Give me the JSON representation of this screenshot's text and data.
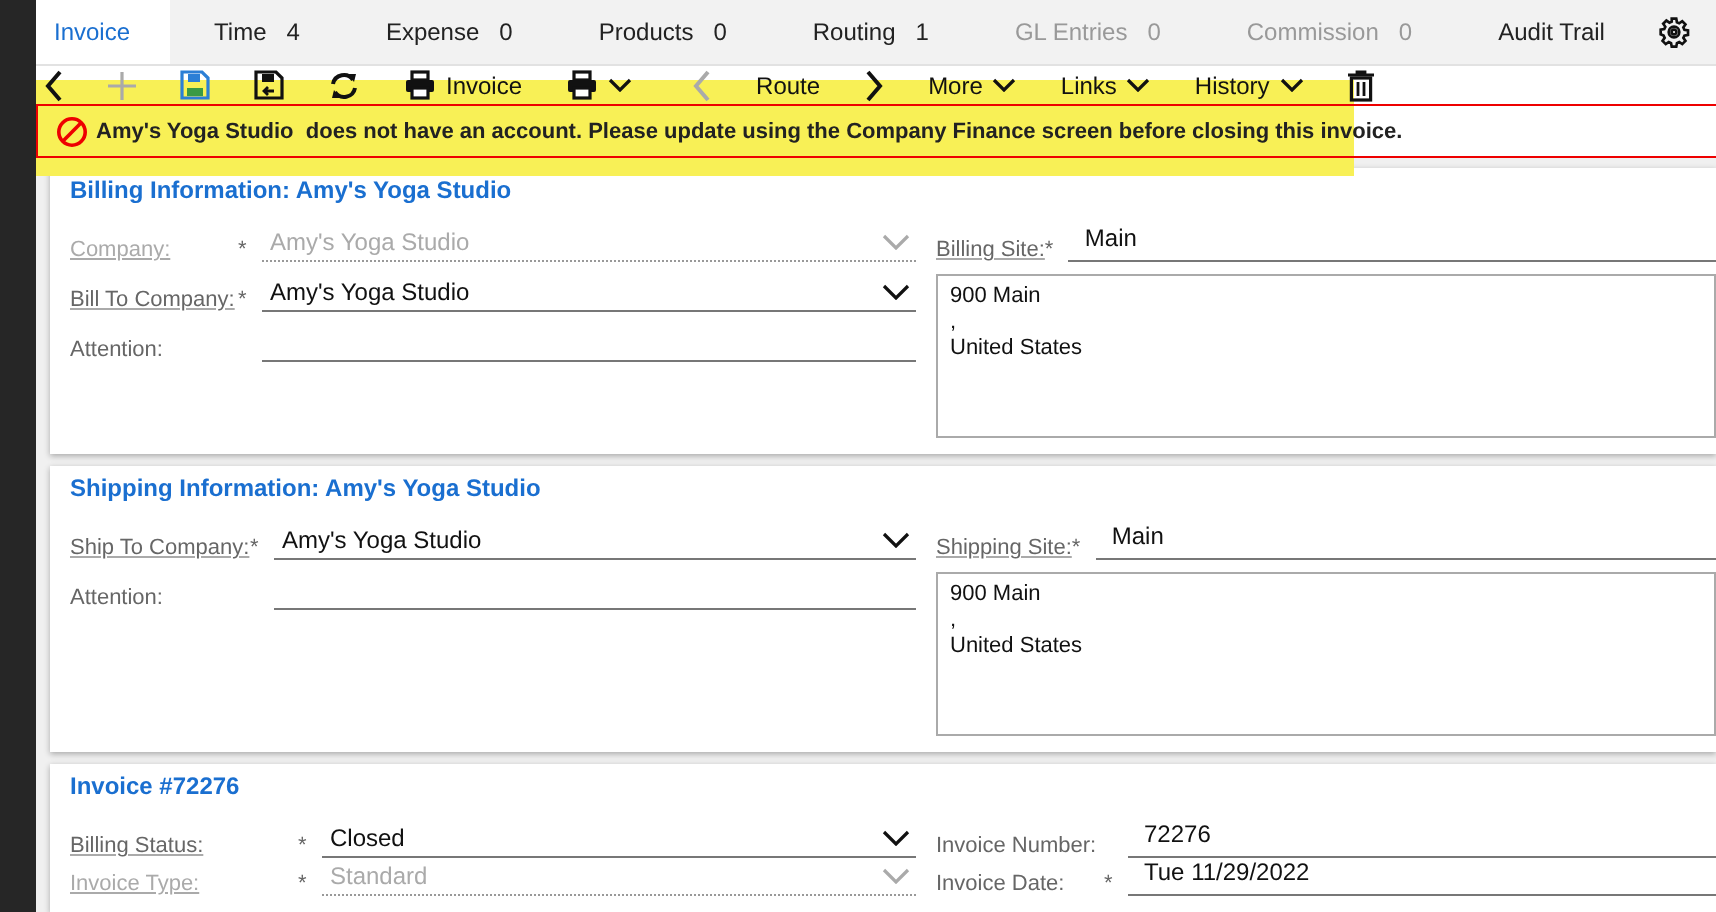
{
  "tabs": [
    {
      "label": "Invoice",
      "selected": true,
      "disabled": false
    },
    {
      "label": "Time",
      "count": "4",
      "selected": false,
      "disabled": false
    },
    {
      "label": "Expense",
      "count": "0",
      "selected": false,
      "disabled": false
    },
    {
      "label": "Products",
      "count": "0",
      "selected": false,
      "disabled": false
    },
    {
      "label": "Routing",
      "count": "1",
      "selected": false,
      "disabled": false
    },
    {
      "label": "GL Entries",
      "count": "0",
      "selected": false,
      "disabled": true
    },
    {
      "label": "Commission",
      "count": "0",
      "selected": false,
      "disabled": true
    },
    {
      "label": "Audit Trail",
      "selected": false,
      "disabled": false
    }
  ],
  "toolbar": [
    {
      "kind": "back",
      "disabled": false
    },
    {
      "kind": "add",
      "disabled": true
    },
    {
      "kind": "save",
      "disabled": false
    },
    {
      "kind": "save-close",
      "disabled": false
    },
    {
      "kind": "refresh",
      "disabled": false
    },
    {
      "kind": "print",
      "label": "Invoice",
      "disabled": false
    },
    {
      "kind": "print-menu",
      "disabled": false
    },
    {
      "kind": "prev",
      "disabled": true
    },
    {
      "kind": "label",
      "label": "Route",
      "disabled": false
    },
    {
      "kind": "next",
      "disabled": false
    },
    {
      "kind": "menu",
      "label": "More",
      "disabled": false
    },
    {
      "kind": "menu",
      "label": "Links",
      "disabled": false
    },
    {
      "kind": "menu",
      "label": "History",
      "disabled": false
    },
    {
      "kind": "delete",
      "disabled": false
    }
  ],
  "alert": {
    "subject": "Amy's Yoga Studio",
    "message": "does not have an account. Please update using the Company Finance screen before closing this invoice."
  },
  "sections": [
    {
      "title": "Billing Information: Amy's Yoga Studio",
      "left": [
        {
          "label": "Company:",
          "required_mark": "*",
          "value": "Amy's Yoga Studio",
          "kind": "select",
          "disabled": true
        },
        {
          "label": "Bill To Company:",
          "required_mark": "*",
          "value": "Amy's Yoga Studio",
          "kind": "select",
          "disabled": false
        },
        {
          "label": "Attention:",
          "kind": "text"
        }
      ],
      "site": {
        "label": "Billing Site:",
        "required_mark": "*",
        "value": "Main"
      },
      "address": [
        "900 Main",
        ",",
        "United States"
      ]
    },
    {
      "title": "Shipping Information: Amy's Yoga Studio",
      "left": [
        {
          "label": "Ship To Company:",
          "required_mark": "*",
          "value": "Amy's Yoga Studio",
          "kind": "select",
          "disabled": false
        },
        {
          "label": "Attention:",
          "kind": "text"
        }
      ],
      "site": {
        "label": "Shipping Site:",
        "required_mark": "*",
        "value": "Main"
      },
      "address": [
        "900 Main",
        ",",
        "United States"
      ]
    },
    {
      "title": "Invoice #72276",
      "rows": [
        {
          "left": {
            "label": "Billing Status:",
            "required_mark": "*",
            "value": "Closed",
            "kind": "select",
            "disabled": false
          },
          "right": {
            "label": "Invoice Number:",
            "value": "72276"
          }
        },
        {
          "left": {
            "label": "Invoice Type:",
            "required_mark": "*",
            "value": "Standard",
            "kind": "select",
            "disabled": true
          },
          "right": {
            "label": "Invoice Date:",
            "required_mark": "*",
            "value": "Tue 11/29/2022"
          }
        }
      ]
    }
  ]
}
